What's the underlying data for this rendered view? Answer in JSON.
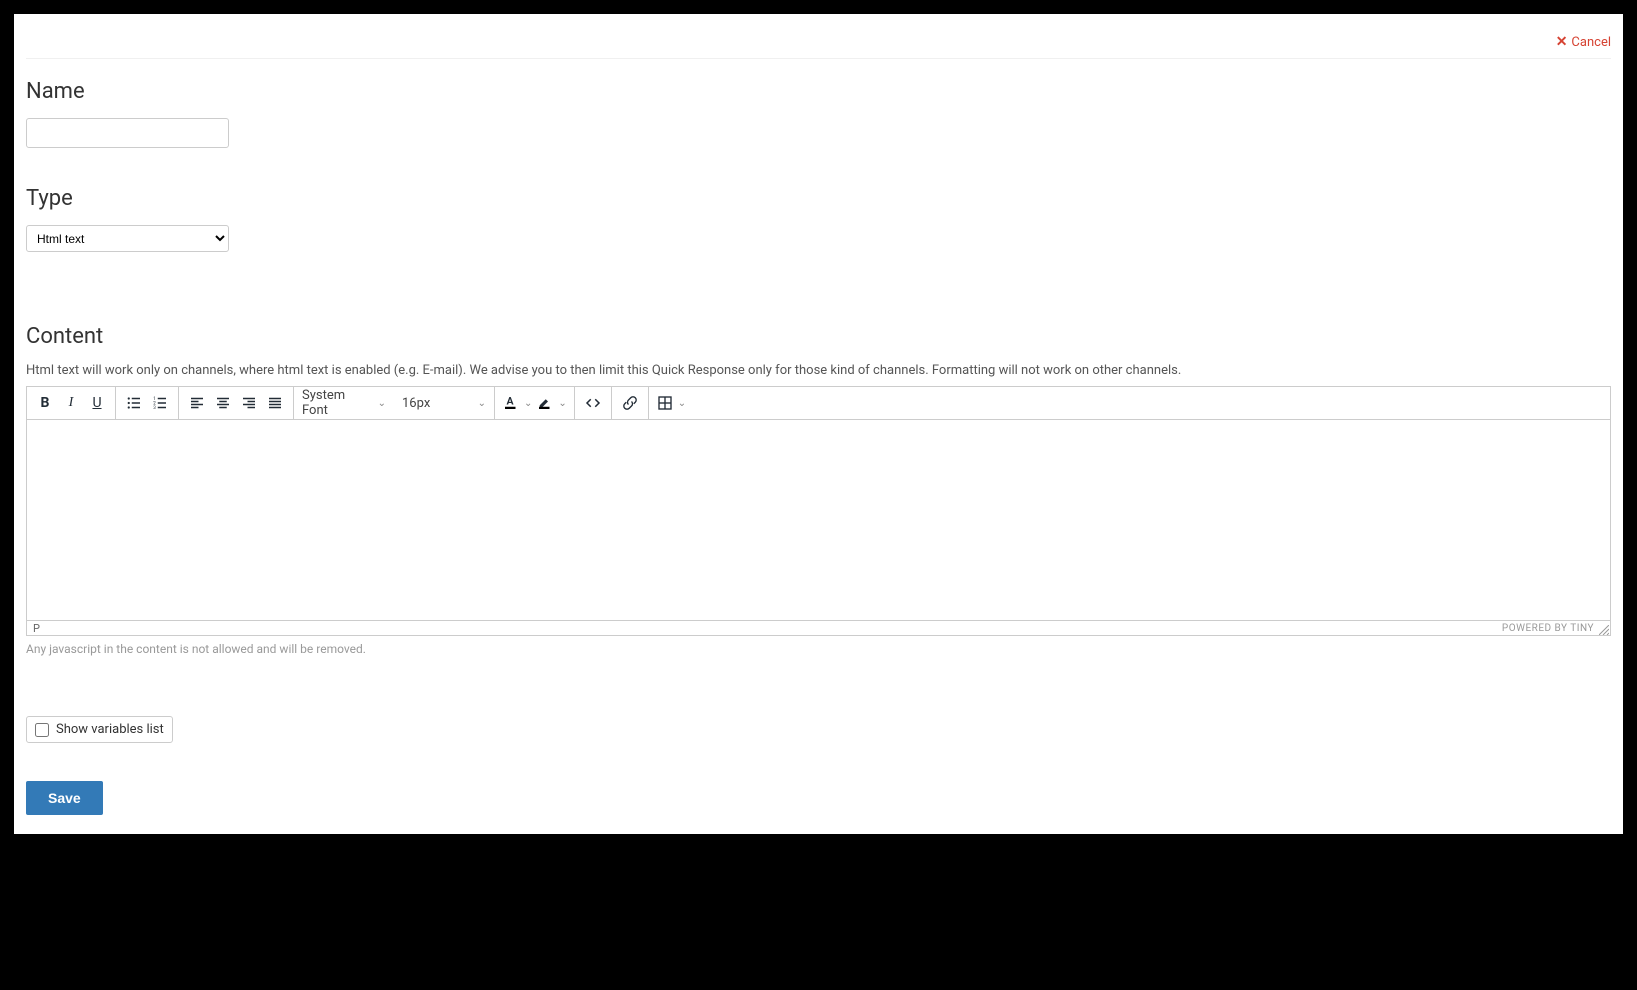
{
  "header": {
    "cancel_label": "Cancel"
  },
  "fields": {
    "name_label": "Name",
    "name_value": "",
    "type_label": "Type",
    "type_selected": "Html text",
    "content_label": "Content",
    "content_help": "Html text will work only on channels, where html text is enabled (e.g. E-mail). We advise you to then limit this Quick Response only for those kind of channels. Formatting will not work on other channels.",
    "content_warn": "Any javascript in the content is not allowed and will be removed."
  },
  "editor": {
    "font_family": "System Font",
    "font_size": "16px",
    "status_path": "P",
    "powered_by": "POWERED BY TINY"
  },
  "checkbox": {
    "label": "Show variables list",
    "checked": false
  },
  "actions": {
    "save_label": "Save"
  }
}
